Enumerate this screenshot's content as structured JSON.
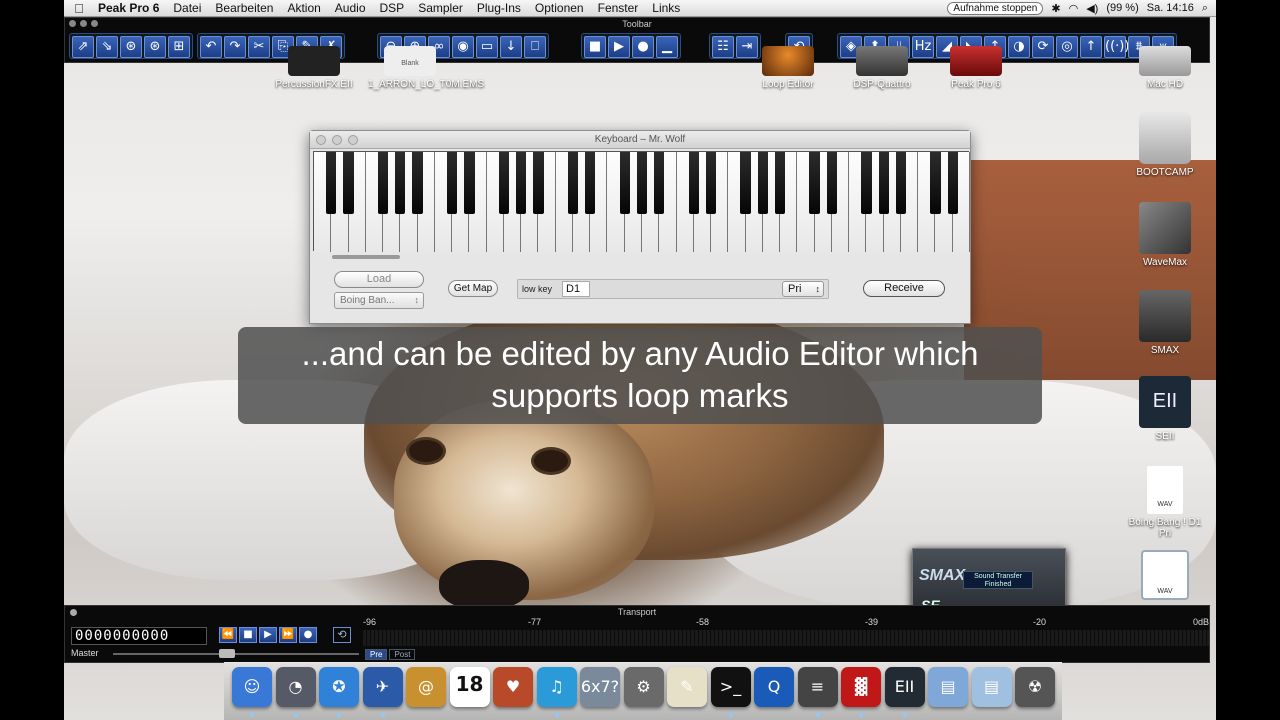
{
  "menubar": {
    "apple": "",
    "app_name": "Peak Pro 6",
    "menus": [
      "Datei",
      "Bearbeiten",
      "Aktion",
      "Audio",
      "DSP",
      "Sampler",
      "Plug-Ins",
      "Optionen",
      "Fenster",
      "Links"
    ],
    "record_status": "Aufnahme stoppen",
    "bluetooth": "✱",
    "wifi": "◠",
    "volume": "◀)",
    "battery": "(99 %)",
    "clock": "Sa. 14:16",
    "search": "⌕"
  },
  "toolbar": {
    "title": "Toolbar",
    "groups": [
      [
        "⇗",
        "⇘",
        "⊛",
        "⊛",
        "⊞"
      ],
      [
        "↶",
        "↷",
        "✂",
        "⎘",
        "✎",
        "✗"
      ],
      [
        "⊖",
        "⊕",
        "∞",
        "◉",
        "▭",
        "↓",
        "⎕"
      ],
      [
        "■",
        "▶",
        "●",
        "▁"
      ],
      [
        "☷",
        "⇥"
      ],
      [
        "⟲"
      ],
      [
        "◈",
        "⬆",
        "⫫",
        "Hz",
        "◢",
        "◣",
        "↕",
        "◑",
        "⟳",
        "◎",
        "↑",
        "((·))",
        "⩩",
        "⩛"
      ]
    ]
  },
  "desktop_icons": {
    "percussion": "PercussionFX.EII",
    "arron": "1_ARRON_LO_T0M.EMS",
    "loop_editor": "Loop Editor",
    "dsp_quattro": "DSP-Quattro",
    "peak_pro": "Peak Pro 6",
    "mac_hd": "Mac HD",
    "bootcamp": "BOOTCAMP",
    "wavemax": "WaveMax",
    "smax": "SMAX",
    "seii": "SEII",
    "boing_bang": "Boing Bang ! D1 Pri",
    "wav_label": "WAV",
    "blank_label": "Blank"
  },
  "keyboard_window": {
    "title": "Keyboard – Mr. Wolf",
    "load_label": "Load",
    "preset_select": "Boing Ban...",
    "getmap_label": "Get Map",
    "low_key_label": "low key",
    "low_key_value": "D1",
    "priority_select": "Pri",
    "receive_label": "Receive",
    "white_key_count": 38
  },
  "subtitle": {
    "line1": "...and can be edited by any Audio Editor which",
    "line2": "supports loop marks"
  },
  "transport": {
    "title": "Transport",
    "counter": "0000000000",
    "buttons": [
      "⏪",
      "■",
      "▶",
      "⏩",
      "●"
    ],
    "loop_icon": "⟲",
    "master_label": "Master",
    "scale": [
      "-96",
      "-77",
      "-58",
      "-39",
      "-20",
      "0dB"
    ],
    "pre_label": "Pre",
    "post_label": "Post"
  },
  "notification": {
    "brand": "SMAX",
    "message": "Sound Transfer Finished",
    "edition": "SE"
  },
  "dock": {
    "items": [
      "☺",
      "◔",
      "✪",
      "✈",
      "@",
      "18",
      "♥",
      "♫",
      "6x7?",
      "⚙",
      "✎",
      ">_",
      "Q",
      "≡",
      "▓",
      "EII",
      "▤",
      "▤",
      "☢"
    ],
    "colors": [
      "#3a78d8",
      "#555a66",
      "#2f82d8",
      "#2a5aa8",
      "#c8902e",
      "#ffffff",
      "#b84a2a",
      "#2a9ad8",
      "#7a8a9a",
      "#6a6a6a",
      "#e6e0c8",
      "#111111",
      "#1a5ab8",
      "#444444",
      "#c01818",
      "#222a34",
      "#7fa8d8",
      "#9fc0e0",
      "#555555"
    ]
  }
}
